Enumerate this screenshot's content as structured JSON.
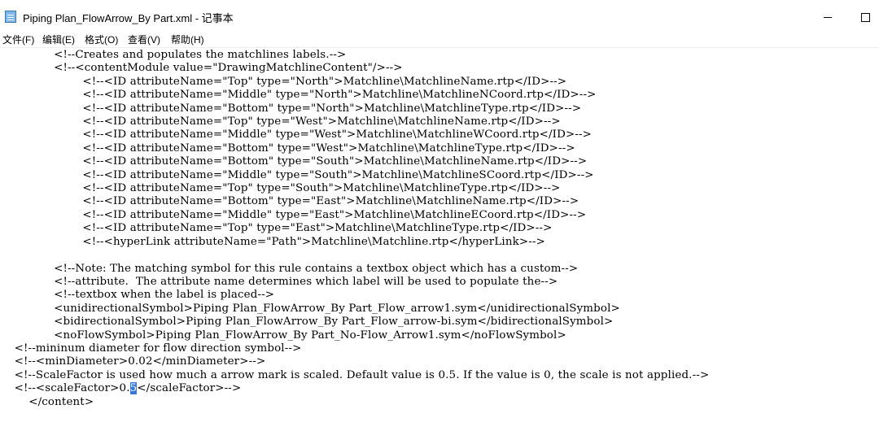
{
  "window": {
    "title": "Piping Plan_FlowArrow_By Part.xml - 记事本",
    "icon": "notepad-icon"
  },
  "menu": [
    "文件(F)",
    "编辑(E)",
    "格式(O)",
    "查看(V)",
    "帮助(H)"
  ],
  "editor": {
    "lines": [
      "               <!--Creates and populates the matchlines labels.-->",
      "               <!--<contentModule value=\"DrawingMatchlineContent\"/>-->",
      "                       <!--<ID attributeName=\"Top\" type=\"North\">Matchline\\MatchlineName.rtp</ID>-->",
      "                       <!--<ID attributeName=\"Middle\" type=\"North\">Matchline\\MatchlineNCoord.rtp</ID>-->",
      "                       <!--<ID attributeName=\"Bottom\" type=\"North\">Matchline\\MatchlineType.rtp</ID>-->",
      "                       <!--<ID attributeName=\"Top\" type=\"West\">Matchline\\MatchlineName.rtp</ID>-->",
      "                       <!--<ID attributeName=\"Middle\" type=\"West\">Matchline\\MatchlineWCoord.rtp</ID>-->",
      "                       <!--<ID attributeName=\"Bottom\" type=\"West\">Matchline\\MatchlineType.rtp</ID>-->",
      "                       <!--<ID attributeName=\"Bottom\" type=\"South\">Matchline\\MatchlineName.rtp</ID>-->",
      "                       <!--<ID attributeName=\"Middle\" type=\"South\">Matchline\\MatchlineSCoord.rtp</ID>-->",
      "                       <!--<ID attributeName=\"Top\" type=\"South\">Matchline\\MatchlineType.rtp</ID>-->",
      "                       <!--<ID attributeName=\"Bottom\" type=\"East\">Matchline\\MatchlineName.rtp</ID>-->",
      "                       <!--<ID attributeName=\"Middle\" type=\"East\">Matchline\\MatchlineECoord.rtp</ID>-->",
      "                       <!--<ID attributeName=\"Top\" type=\"East\">Matchline\\MatchlineType.rtp</ID>-->",
      "                       <!--<hyperLink attributeName=\"Path\">Matchline\\Matchline.rtp</hyperLink>-->",
      "",
      "               <!--Note: The matching symbol for this rule contains a textbox object which has a custom-->",
      "               <!--attribute.  The attribute name determines which label will be used to populate the-->",
      "               <!--textbox when the label is placed-->",
      "               <unidirectionalSymbol>Piping Plan_FlowArrow_By Part_Flow_arrow1.sym</unidirectionalSymbol>",
      "               <bidirectionalSymbol>Piping Plan_FlowArrow_By Part_Flow_arrow-bi.sym</bidirectionalSymbol>",
      "               <noFlowSymbol>Piping Plan_FlowArrow_By Part_No-Flow_Arrow1.sym</noFlowSymbol>",
      "    <!--mininum diameter for flow direction symbol-->",
      "    <!--<minDiameter>0.02</minDiameter>-->",
      "    <!--ScaleFactor is used how much a arrow mark is scaled. Default value is 0.5. If the value is 0, the scale is not applied.-->"
    ],
    "scale_line": {
      "before": "    <!--<scaleFactor>0.",
      "selected": "5",
      "after": "</scaleFactor>-->"
    },
    "last_line": "        </content>"
  },
  "colors": {
    "selection": "#3a78d6",
    "icon": "#7fb7e6"
  }
}
